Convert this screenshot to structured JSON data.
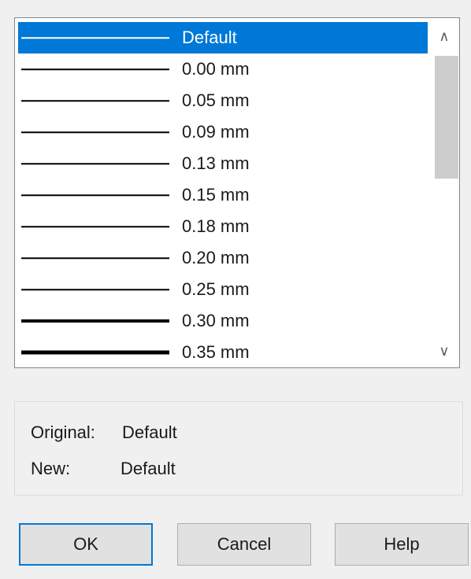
{
  "lineweights": {
    "items": [
      {
        "label": "Default",
        "thickness": 1.5,
        "selected": true
      },
      {
        "label": "0.00 mm",
        "thickness": 1.5,
        "selected": false
      },
      {
        "label": "0.05 mm",
        "thickness": 1.5,
        "selected": false
      },
      {
        "label": "0.09 mm",
        "thickness": 1.5,
        "selected": false
      },
      {
        "label": "0.13 mm",
        "thickness": 1.5,
        "selected": false
      },
      {
        "label": "0.15 mm",
        "thickness": 1.5,
        "selected": false
      },
      {
        "label": "0.18 mm",
        "thickness": 1.5,
        "selected": false
      },
      {
        "label": "0.20 mm",
        "thickness": 1.5,
        "selected": false
      },
      {
        "label": "0.25 mm",
        "thickness": 1.5,
        "selected": false
      },
      {
        "label": "0.30 mm",
        "thickness": 4,
        "selected": false
      },
      {
        "label": "0.35 mm",
        "thickness": 5,
        "selected": false
      }
    ],
    "selected_color": "#0078d7"
  },
  "scrollbar": {
    "up_icon": "chevron-up-icon",
    "down_icon": "chevron-down-icon"
  },
  "info": {
    "original_label": "Original:",
    "original_value": "Default",
    "new_label": "New:",
    "new_value": "Default"
  },
  "buttons": {
    "ok": "OK",
    "cancel": "Cancel",
    "help": "Help"
  }
}
